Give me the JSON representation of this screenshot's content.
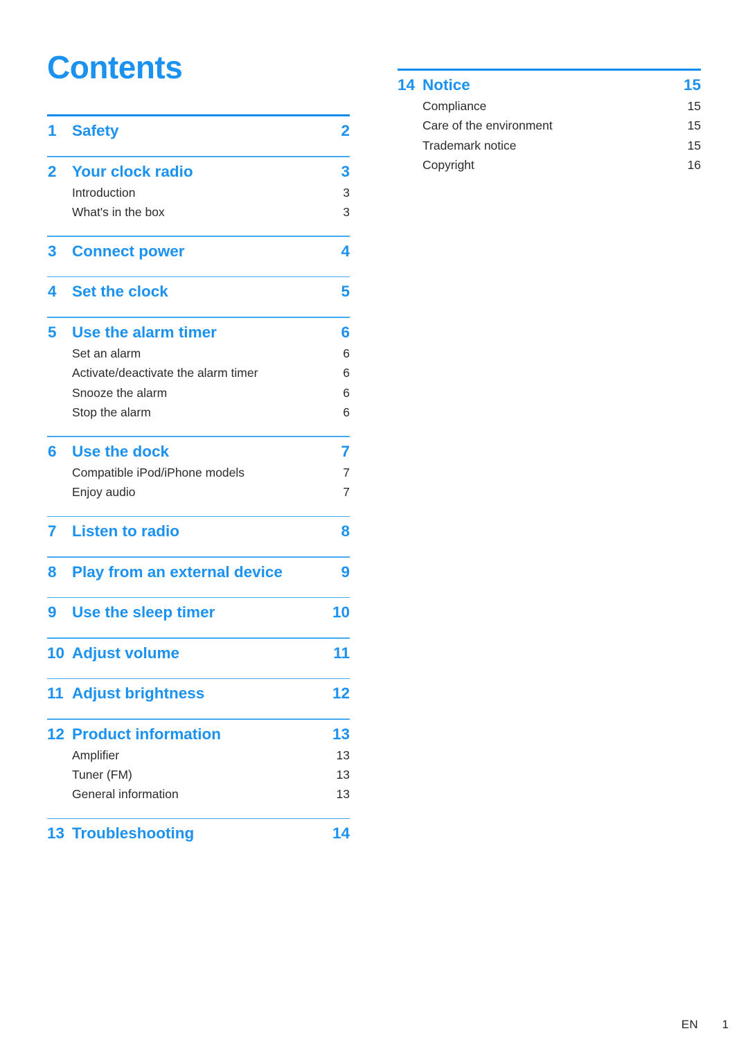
{
  "document": {
    "title": "Contents",
    "accent_color": "#1b91f0",
    "rule_color": "#41a9f2",
    "body_text_color": "#2b2a29"
  },
  "footer": {
    "language": "EN",
    "page_number": "1"
  },
  "left_column": {
    "groups": [
      {
        "rule": "thick",
        "main": {
          "num": "1",
          "label": "Safety",
          "page": "2"
        },
        "subs": []
      },
      {
        "rule": "thin",
        "main": {
          "num": "2",
          "label": "Your clock radio",
          "page": "3"
        },
        "subs": [
          {
            "label": "Introduction",
            "page": "3"
          },
          {
            "label": "What's in the box",
            "page": "3"
          }
        ]
      },
      {
        "rule": "thin",
        "main": {
          "num": "3",
          "label": "Connect power",
          "page": "4"
        },
        "subs": []
      },
      {
        "rule": "thin",
        "main": {
          "num": "4",
          "label": "Set the clock",
          "page": "5"
        },
        "subs": []
      },
      {
        "rule": "thin",
        "main": {
          "num": "5",
          "label": "Use the alarm timer",
          "page": "6"
        },
        "subs": [
          {
            "label": "Set an alarm",
            "page": "6"
          },
          {
            "label": "Activate/deactivate the alarm timer",
            "page": "6"
          },
          {
            "label": "Snooze the alarm",
            "page": "6"
          },
          {
            "label": "Stop the alarm",
            "page": "6"
          }
        ]
      },
      {
        "rule": "thin",
        "main": {
          "num": "6",
          "label": "Use the dock",
          "page": "7"
        },
        "subs": [
          {
            "label": "Compatible iPod/iPhone models",
            "page": "7"
          },
          {
            "label": "Enjoy audio",
            "page": "7"
          }
        ]
      },
      {
        "rule": "thin",
        "main": {
          "num": "7",
          "label": "Listen to radio",
          "page": "8"
        },
        "subs": []
      },
      {
        "rule": "thin",
        "main": {
          "num": "8",
          "label": "Play from an external device",
          "page": "9"
        },
        "subs": []
      },
      {
        "rule": "thin",
        "main": {
          "num": "9",
          "label": "Use the sleep timer",
          "page": "10"
        },
        "subs": []
      },
      {
        "rule": "thin",
        "main": {
          "num": "10",
          "label": "Adjust volume",
          "page": "11"
        },
        "subs": []
      },
      {
        "rule": "thin",
        "main": {
          "num": "11",
          "label": "Adjust brightness",
          "page": "12"
        },
        "subs": []
      },
      {
        "rule": "thin",
        "main": {
          "num": "12",
          "label": "Product information",
          "page": "13"
        },
        "subs": [
          {
            "label": "Amplifier",
            "page": "13"
          },
          {
            "label": "Tuner (FM)",
            "page": "13"
          },
          {
            "label": "General information",
            "page": "13"
          }
        ]
      },
      {
        "rule": "thin",
        "main": {
          "num": "13",
          "label": "Troubleshooting",
          "page": "14"
        },
        "subs": []
      }
    ]
  },
  "right_column": {
    "groups": [
      {
        "rule": "thick",
        "main": {
          "num": "14",
          "label": "Notice",
          "page": "15"
        },
        "subs": [
          {
            "label": "Compliance",
            "page": "15"
          },
          {
            "label": "Care of the environment",
            "page": "15"
          },
          {
            "label": "Trademark notice",
            "page": "15"
          },
          {
            "label": "Copyright",
            "page": "16"
          }
        ]
      }
    ]
  }
}
